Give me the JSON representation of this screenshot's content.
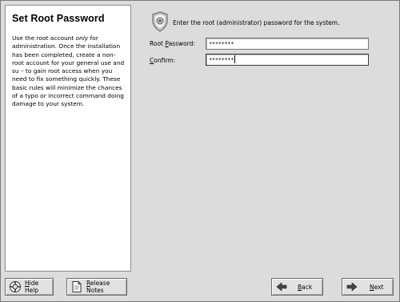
{
  "help": {
    "title": "Set Root Password",
    "text_before_em": "Use the root account ",
    "text_em": "only",
    "text_after_em": " for administration. Once the installation has been completed, create a non-root account for your general use and su  – to gain root access when you need to fix something quickly. These basic rules will minimize the chances of a typo or incorrect command doing damage to your system."
  },
  "main": {
    "prompt": "Enter the root (administrator) password for the system.",
    "root_password": {
      "label_pre": "Root ",
      "label_u": "P",
      "label_post": "assword:",
      "value": "********"
    },
    "confirm": {
      "label_pre": "",
      "label_u": "C",
      "label_post": "onfirm:",
      "value": "********"
    }
  },
  "buttons": {
    "hide_help": {
      "pre": "",
      "u": "H",
      "post": "ide Help"
    },
    "release_notes": {
      "pre": "",
      "u": "R",
      "post": "elease Notes"
    },
    "back": {
      "pre": "",
      "u": "B",
      "post": "ack"
    },
    "next": {
      "pre": "",
      "u": "N",
      "post": "ext"
    }
  },
  "icons": {
    "prompt": "shield-icon",
    "hide_help": "lifebuoy-icon",
    "release_notes": "document-icon",
    "back": "arrow-left-icon",
    "next": "arrow-right-icon"
  }
}
